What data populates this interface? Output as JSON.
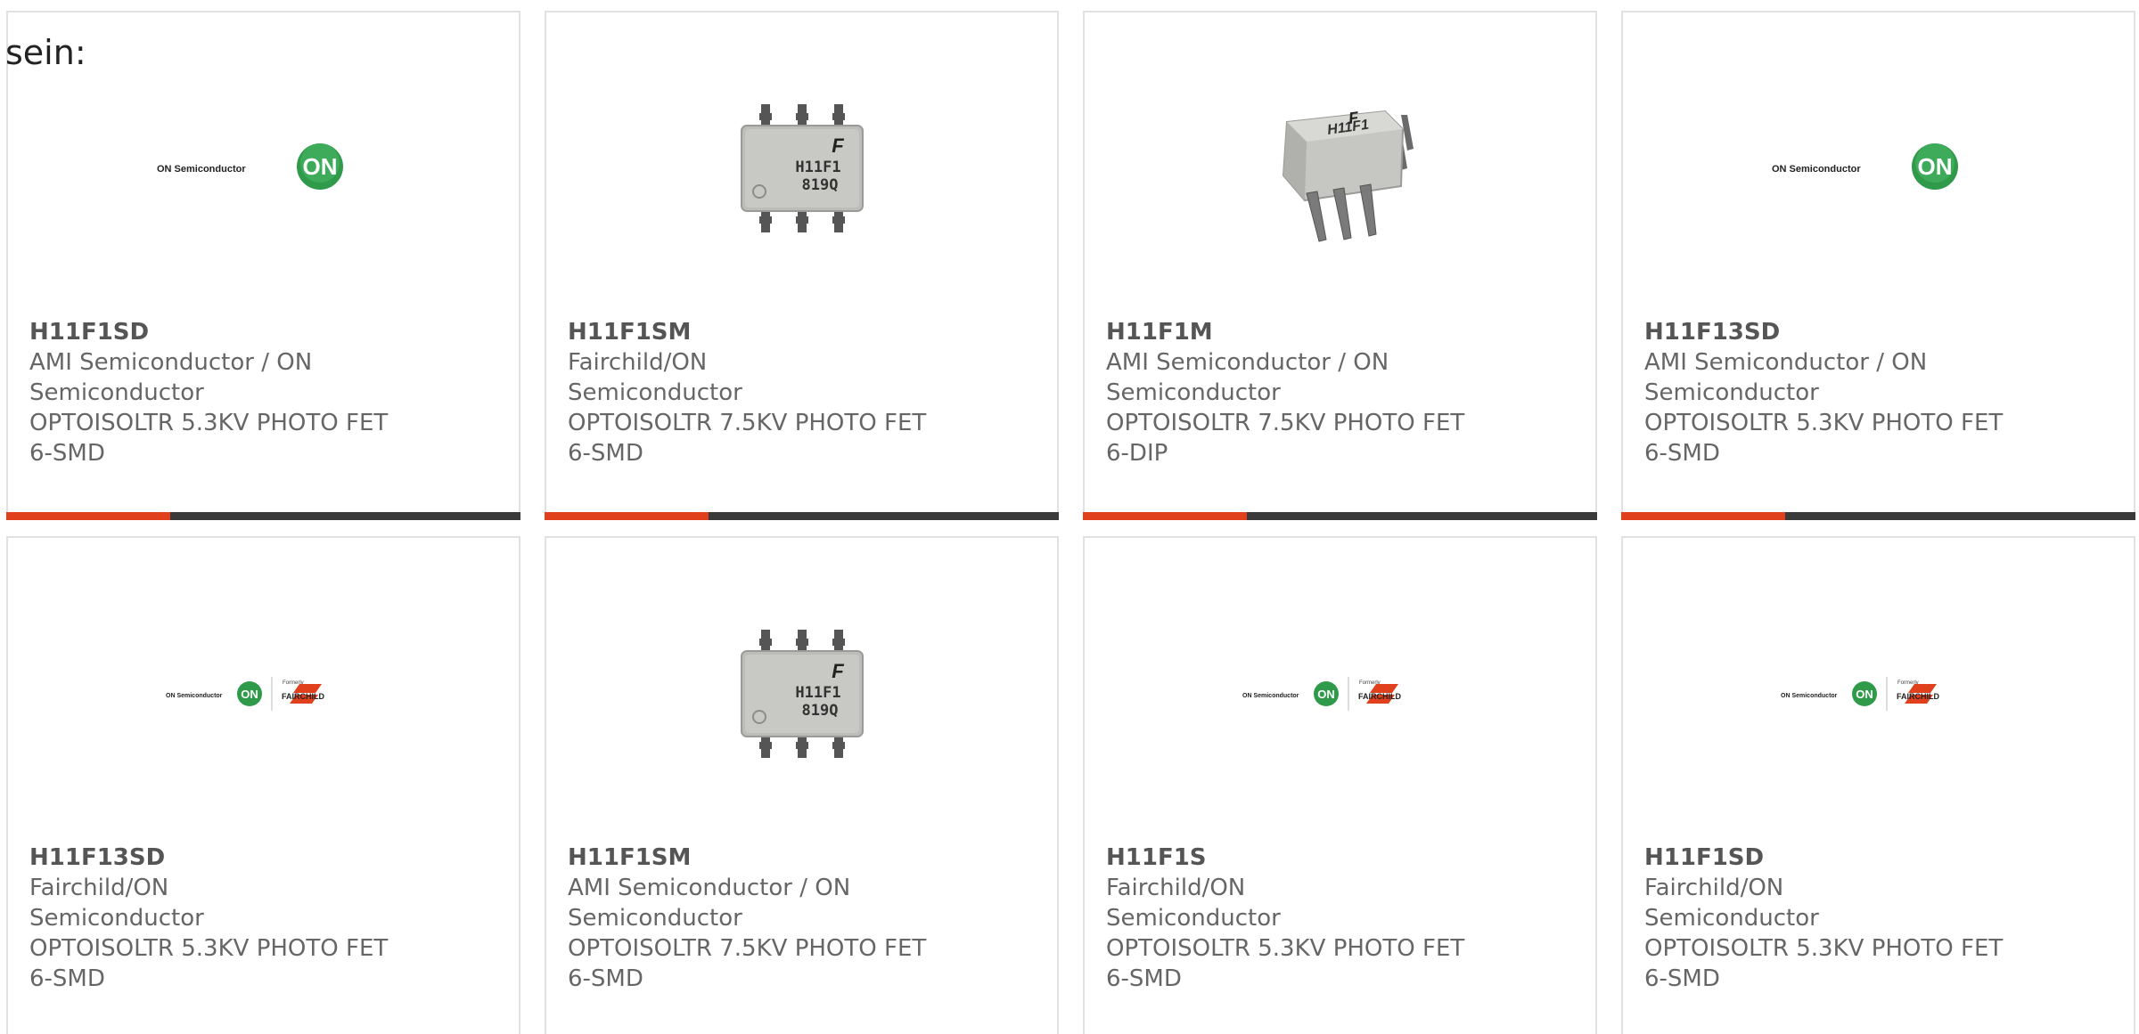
{
  "intro_text": "sein:",
  "products": [
    {
      "part_number": "H11F1SD",
      "manufacturer": "AMI Semiconductor / ON Semiconductor",
      "description": "OPTOISOLTR 5.3KV PHOTO FET",
      "package": "6-SMD",
      "image": "on-semiconductor-logo",
      "logo_text": "ON Semiconductor",
      "logo_mark": "ON"
    },
    {
      "part_number": "H11F1SM",
      "manufacturer": "Fairchild/ON Semiconductor",
      "description": "OPTOISOLTR 7.5KV PHOTO FET",
      "package": "6-SMD",
      "image": "smd-chip-photo",
      "chip_marking_line1": "H11F1",
      "chip_marking_line2": "819Q"
    },
    {
      "part_number": "H11F1M",
      "manufacturer": "AMI Semiconductor / ON Semiconductor",
      "description": "OPTOISOLTR 7.5KV PHOTO FET",
      "package": "6-DIP",
      "image": "dip-chip-photo",
      "chip_marking_line1": "H11F1"
    },
    {
      "part_number": "H11F13SD",
      "manufacturer": "AMI Semiconductor / ON Semiconductor",
      "description": "OPTOISOLTR 5.3KV PHOTO FET",
      "package": "6-SMD",
      "image": "on-semiconductor-logo",
      "logo_text": "ON Semiconductor",
      "logo_mark": "ON"
    },
    {
      "part_number": "H11F13SD",
      "manufacturer": "Fairchild/ON Semiconductor",
      "description": "OPTOISOLTR 5.3KV PHOTO FET",
      "package": "6-SMD",
      "image": "on-fairchild-logo",
      "logo_text": "ON Semiconductor",
      "logo_mark": "ON",
      "formerly_text": "Formerly",
      "fairchild_text": "FAIRCHILD"
    },
    {
      "part_number": "H11F1SM",
      "manufacturer": "AMI Semiconductor / ON Semiconductor",
      "description": "OPTOISOLTR 7.5KV PHOTO FET",
      "package": "6-SMD",
      "image": "smd-chip-photo",
      "chip_marking_line1": "H11F1",
      "chip_marking_line2": "819Q"
    },
    {
      "part_number": "H11F1S",
      "manufacturer": "Fairchild/ON Semiconductor",
      "description": "OPTOISOLTR 5.3KV PHOTO FET",
      "package": "6-SMD",
      "image": "on-fairchild-logo",
      "logo_text": "ON Semiconductor",
      "logo_mark": "ON",
      "formerly_text": "Formerly",
      "fairchild_text": "FAIRCHILD"
    },
    {
      "part_number": "H11F1SD",
      "manufacturer": "Fairchild/ON Semiconductor",
      "description": "OPTOISOLTR 5.3KV PHOTO FET",
      "package": "6-SMD",
      "image": "on-fairchild-logo",
      "logo_text": "ON Semiconductor",
      "logo_mark": "ON",
      "formerly_text": "Formerly",
      "fairchild_text": "FAIRCHILD"
    }
  ],
  "colors": {
    "accent_bar": "#e0401c",
    "dark_bar": "#3a3a3a",
    "card_border": "#e1e1e1",
    "text": "#666666",
    "on_logo_green": "#2e9a4a"
  }
}
